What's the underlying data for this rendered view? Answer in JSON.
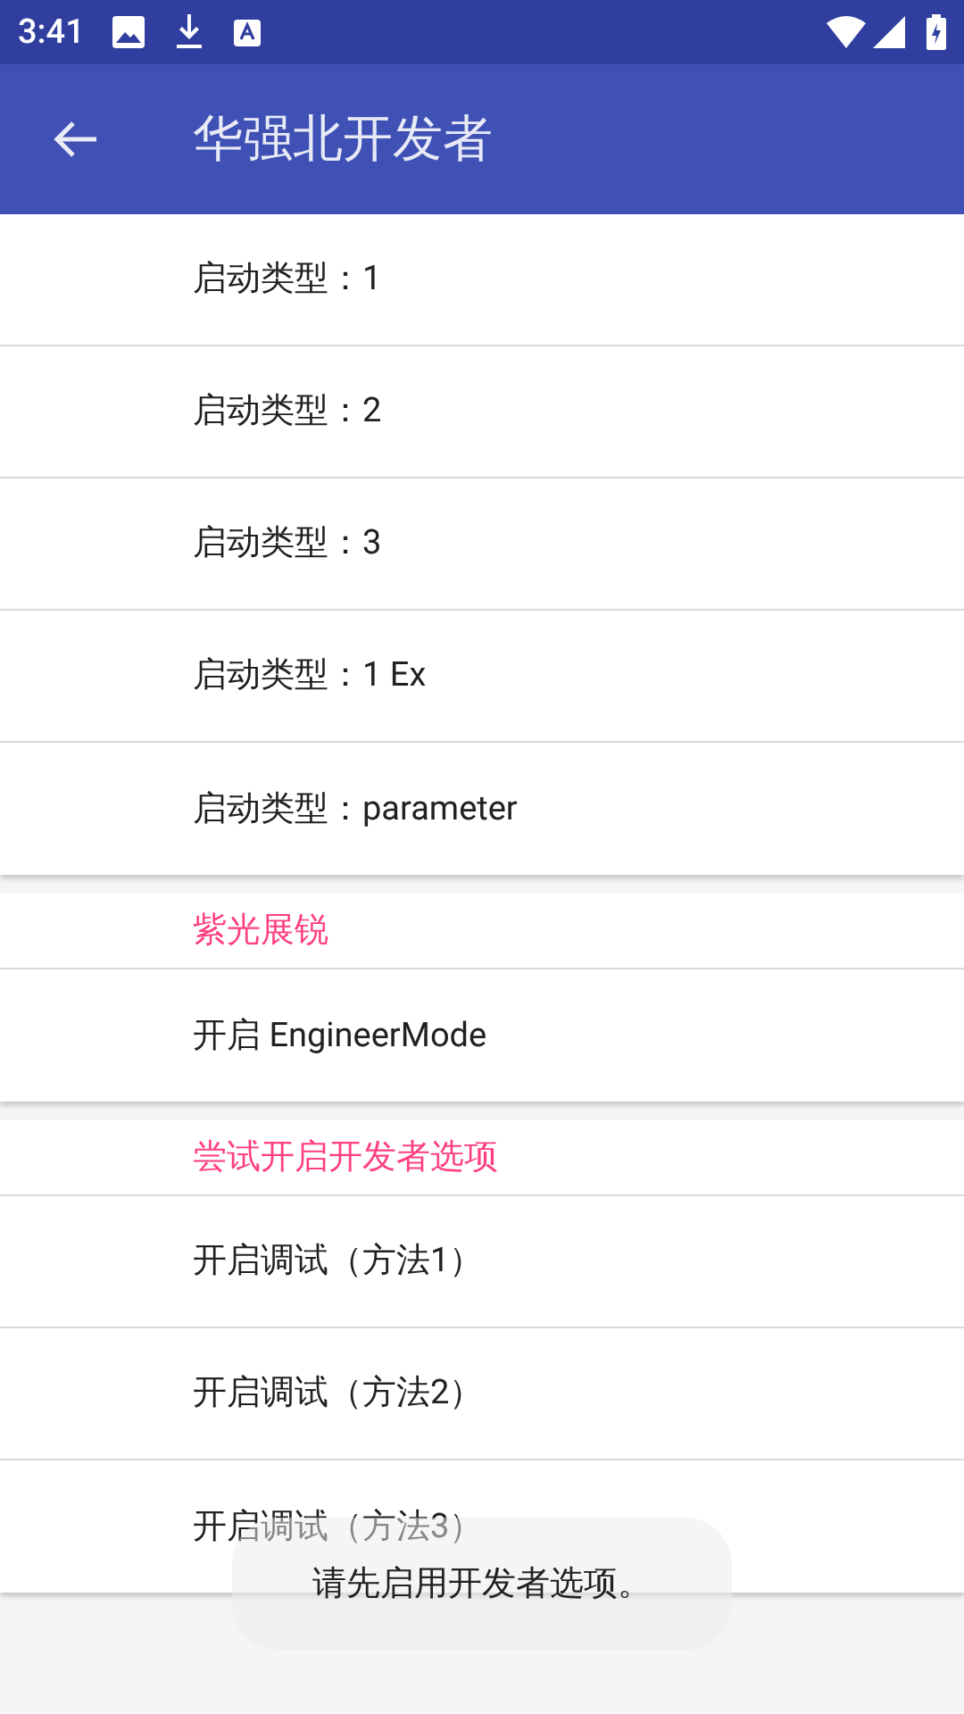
{
  "status_bar": {
    "time": "3:41"
  },
  "toolbar": {
    "title": "华强北开发者"
  },
  "sections": [
    {
      "items": [
        "启动类型：1",
        "启动类型：2",
        "启动类型：3",
        "启动类型：1 Ex",
        "启动类型：parameter"
      ]
    },
    {
      "header": "紫光展锐",
      "items": [
        "开启 EngineerMode"
      ]
    },
    {
      "header": "尝试开启开发者选项",
      "items": [
        "开启调试（方法1）",
        "开启调试（方法2）",
        "开启调试（方法3）"
      ]
    }
  ],
  "toast": "请先启用开发者选项。"
}
